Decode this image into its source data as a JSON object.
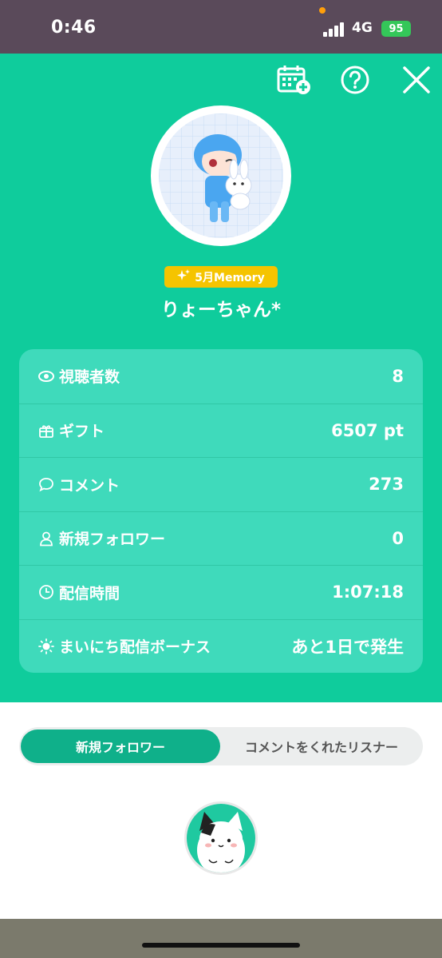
{
  "status": {
    "time": "0:46",
    "network": "4G",
    "battery": "95"
  },
  "header": {
    "badge_label": "5月Memory",
    "username": "りょーちゃん*",
    "colors": {
      "accent": "#0fcc9c",
      "card": "#3fdabb",
      "badge": "#f5c400"
    }
  },
  "stats": {
    "rows": [
      {
        "icon": "eye-icon",
        "label": "視聴者数",
        "value": "8"
      },
      {
        "icon": "gift-icon",
        "label": "ギフト",
        "value": "6507 pt"
      },
      {
        "icon": "comment-icon",
        "label": "コメント",
        "value": "273"
      },
      {
        "icon": "person-icon",
        "label": "新規フォロワー",
        "value": "0"
      },
      {
        "icon": "clock-icon",
        "label": "配信時間",
        "value": "1:07:18"
      },
      {
        "icon": "sun-icon",
        "label": "まいにち配信ボーナス",
        "value": "あと1日で発生"
      }
    ]
  },
  "tabs": {
    "active": "新規フォロワー",
    "inactive": "コメントをくれたリスナー"
  }
}
